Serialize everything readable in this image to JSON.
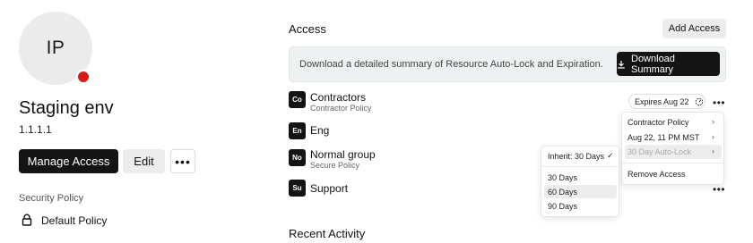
{
  "resource": {
    "initials": "IP",
    "name": "Staging env",
    "ip": "1.1.1.1",
    "status_color": "#d71c1c"
  },
  "actions": {
    "manage_label": "Manage Access",
    "edit_label": "Edit",
    "more_label": "•••"
  },
  "security": {
    "label": "Security Policy",
    "policy": "Default Policy",
    "icon": "lock-icon"
  },
  "access": {
    "title": "Access",
    "add_label": "Add Access",
    "banner_text": "Download a detailed summary of Resource Auto-Lock and Expiration.",
    "download_label": "Download Summary",
    "rows": [
      {
        "badge": "Co",
        "name": "Contractors",
        "sub": "Contractor Policy"
      },
      {
        "badge": "En",
        "name": "Eng",
        "sub": ""
      },
      {
        "badge": "No",
        "name": "Normal group",
        "sub": "Secure Policy"
      },
      {
        "badge": "Su",
        "name": "Support",
        "sub": ""
      }
    ],
    "expires_label": "Expires Aug 22",
    "row_more": "•••"
  },
  "context_menu": {
    "items": [
      {
        "label": "Contractor Policy",
        "chevron": "›"
      },
      {
        "label": "Aug 22, 11 PM MST",
        "chevron": "›"
      },
      {
        "label": "30 Day Auto-Lock",
        "chevron": "›"
      }
    ],
    "remove_label": "Remove Access"
  },
  "autolock_menu": {
    "inherit_label": "Inherit: 30 Days",
    "check": "✓",
    "options": [
      "30 Days",
      "60 Days",
      "90 Days"
    ],
    "highlighted": "60 Days"
  },
  "recent": {
    "title": "Recent Activity"
  }
}
